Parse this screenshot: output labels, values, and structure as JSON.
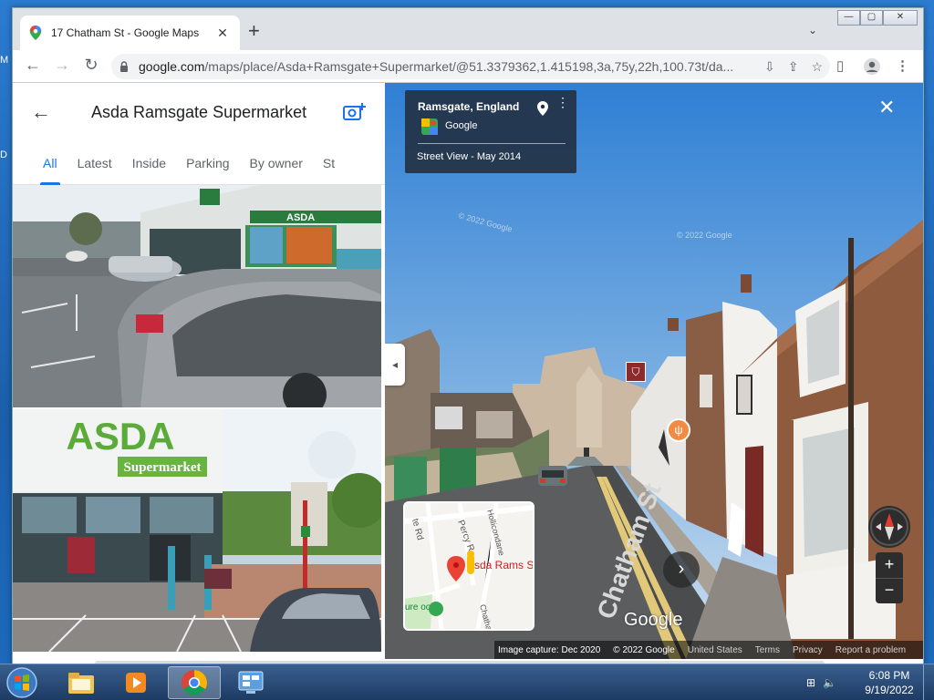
{
  "desktop": {
    "edge_text_1": "M",
    "edge_text_2": "D"
  },
  "browser": {
    "tab_title": "17 Chatham St - Google Maps",
    "tab_close": "✕",
    "new_tab": "+",
    "tab_search": "⌄",
    "url_host": "google.com",
    "url_rest": "/maps/place/Asda+Ramsgate+Supermarket/@51.3379362,1.415198,3a,75y,22h,100.73t/da...",
    "window_controls": {
      "minimize": "—",
      "maximize": "▢",
      "close": "✕"
    }
  },
  "left_pane": {
    "title": "Asda Ramsgate Supermarket",
    "tabs": [
      "All",
      "Latest",
      "Inside",
      "Parking",
      "By owner",
      "St"
    ],
    "active_tab": "All"
  },
  "street_view": {
    "place": "Ramsgate, England",
    "provider": "Google",
    "date_label": "Street View - May 2014",
    "street_label": "Chatham St",
    "google_logo": "Google",
    "minimap_labels": {
      "road_1": "te Rd",
      "road_2": "Percy R",
      "road_3": "Hollicondane",
      "place": "Asda Rams Supermark",
      "park": "ure ool",
      "street": "Chatham"
    },
    "footer": [
      "Image capture: Dec 2020",
      "© 2022 Google",
      "United States",
      "Terms",
      "Privacy",
      "Report a problem"
    ],
    "watermarks": [
      "© 2022 Google",
      "© 2022 Google"
    ]
  },
  "taskbar": {
    "time": "6:08 PM",
    "date": "9/19/2022"
  },
  "colors": {
    "accent": "#1a73e8",
    "sv_panel": "#223042",
    "pin_red": "#ea4335",
    "asda_green": "#78be20"
  },
  "icons": [
    "maps-favicon",
    "back-arrow-icon",
    "forward-arrow-icon",
    "reload-icon",
    "lock-icon",
    "download-icon",
    "share-icon",
    "bookmark-star-icon",
    "side-panel-icon",
    "profile-icon",
    "kebab-menu-icon",
    "add-photo-icon",
    "pin-icon",
    "close-icon",
    "chevron-left-icon",
    "chevron-right-icon",
    "compass-icon",
    "zoom-in-icon",
    "zoom-out-icon",
    "windows-start-icon",
    "explorer-icon",
    "media-player-icon",
    "chrome-icon",
    "control-panel-icon",
    "network-icon",
    "volume-icon"
  ]
}
